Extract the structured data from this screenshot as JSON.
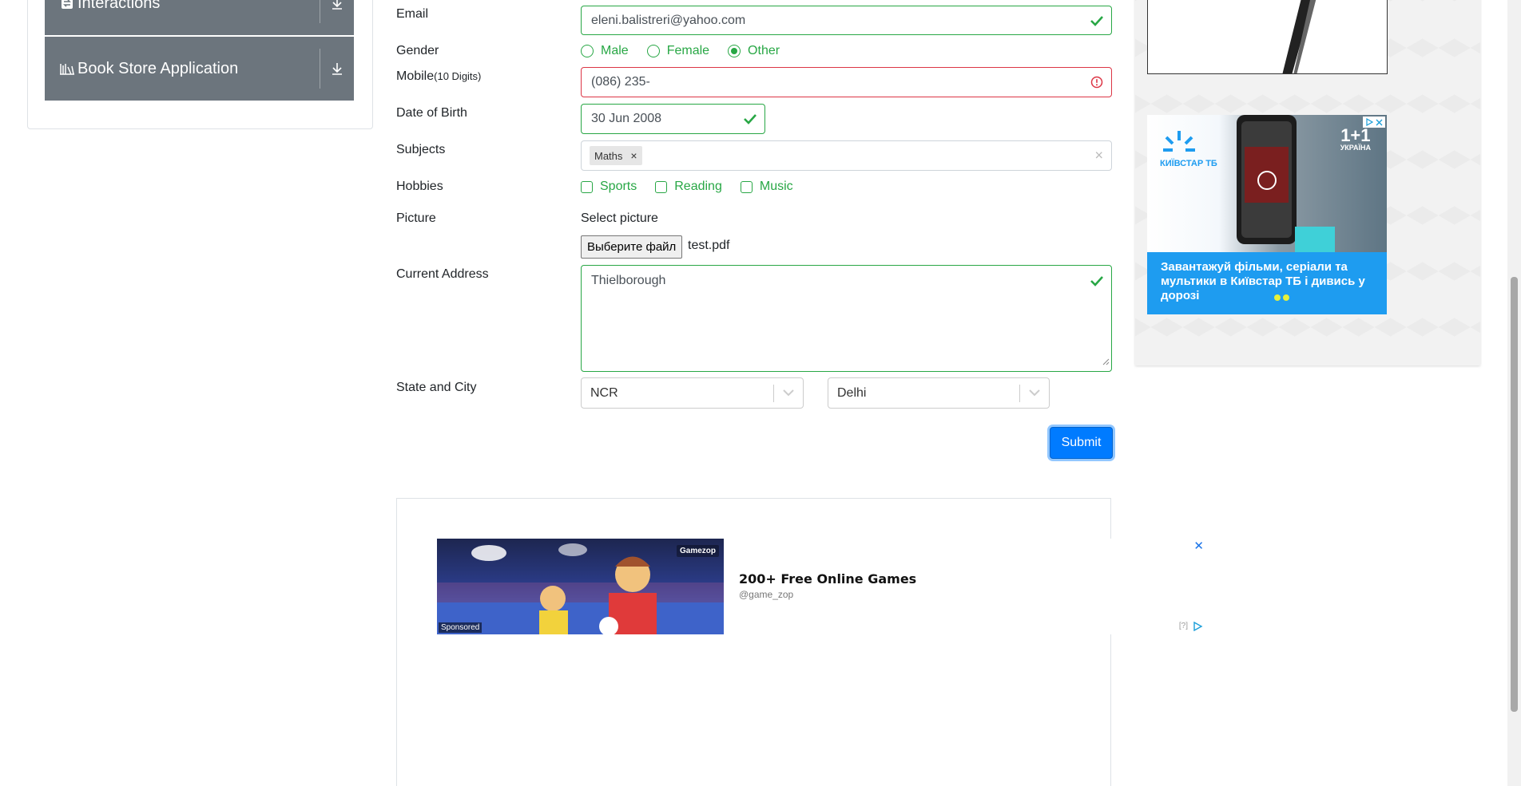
{
  "sidebar": {
    "groups": [
      {
        "title": "Interactions",
        "icon": "interactions-icon",
        "arrow": "download-arrow-icon"
      },
      {
        "title": "Book Store Application",
        "icon": "books-icon",
        "arrow": "download-arrow-icon"
      }
    ]
  },
  "form": {
    "email": {
      "label": "Email",
      "value": "eleni.balistreri@yahoo.com",
      "state": "valid"
    },
    "gender": {
      "label": "Gender",
      "options": [
        "Male",
        "Female",
        "Other"
      ],
      "selected": "Other"
    },
    "mobile": {
      "label": "Mobile",
      "label_hint": "(10 Digits)",
      "value": "(086) 235-",
      "state": "invalid"
    },
    "dob": {
      "label": "Date of Birth",
      "value": "30 Jun 2008",
      "state": "valid"
    },
    "subjects": {
      "label": "Subjects",
      "chips": [
        "Maths"
      ],
      "chip_remove": "×",
      "clear": "×"
    },
    "hobbies": {
      "label": "Hobbies",
      "options": [
        "Sports",
        "Reading",
        "Music"
      ]
    },
    "picture": {
      "label": "Picture",
      "hint": "Select picture",
      "button": "Выберите файл",
      "file": "test.pdf"
    },
    "address": {
      "label": "Current Address",
      "value": "Thielborough",
      "state": "valid"
    },
    "state_city": {
      "label": "State and City",
      "state": "NCR",
      "city": "Delhi"
    },
    "submit": "Submit"
  },
  "bottom_ad": {
    "title": "200+ Free Online Games",
    "handle": "@game_zop",
    "brand": "Gamezop",
    "sponsored": "Sponsored",
    "close": "✕",
    "info": "[?]"
  },
  "right_ad": {
    "brand": "КИЇВСТАР ТБ",
    "channel": "1+1",
    "channel_sub": "УКРАЇНА",
    "text": "Завантажуй фільми, серіали та мультики в Київстар ТБ і дивись у дорозі"
  },
  "colors": {
    "valid": "#28a745",
    "invalid": "#dc3545",
    "primary": "#007bff",
    "sidebar": "#6c757d"
  }
}
